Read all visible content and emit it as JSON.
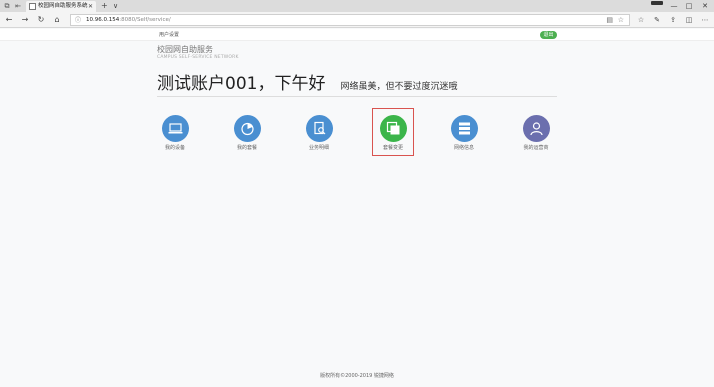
{
  "browser": {
    "tab_title": "校园网自助服务系统",
    "address": "10.96.0.154",
    "address_rest": ":8080/Self/service/",
    "new_tab": "+",
    "tab_menu": "∨",
    "minimize": "—",
    "maximize": "□",
    "close": "✕"
  },
  "nav": {
    "user_menu": "用户设置",
    "logout": "退出"
  },
  "brand": {
    "name_cn": "校园网自助服务",
    "name_en": "CAMPUS SELF-SERVICE NETWORK"
  },
  "greeting": {
    "main": "测试账户001，下午好",
    "sub": "网络虽美，但不要过度沉迷哦"
  },
  "tiles": [
    {
      "label": "我的设备",
      "icon": "laptop-icon",
      "color": "#4a8fd1"
    },
    {
      "label": "我的套餐",
      "icon": "package-icon",
      "color": "#4a8fd1"
    },
    {
      "label": "业务明细",
      "icon": "statement-icon",
      "color": "#4a8fd1"
    },
    {
      "label": "套餐变更",
      "icon": "change-package-icon",
      "color": "#3bb54a"
    },
    {
      "label": "网络信息",
      "icon": "server-icon",
      "color": "#4a8fd1"
    },
    {
      "label": "我的运营商",
      "icon": "user-icon",
      "color": "#6b6fae"
    }
  ],
  "footer": "版权所有©2000-2019 锐捷网络"
}
